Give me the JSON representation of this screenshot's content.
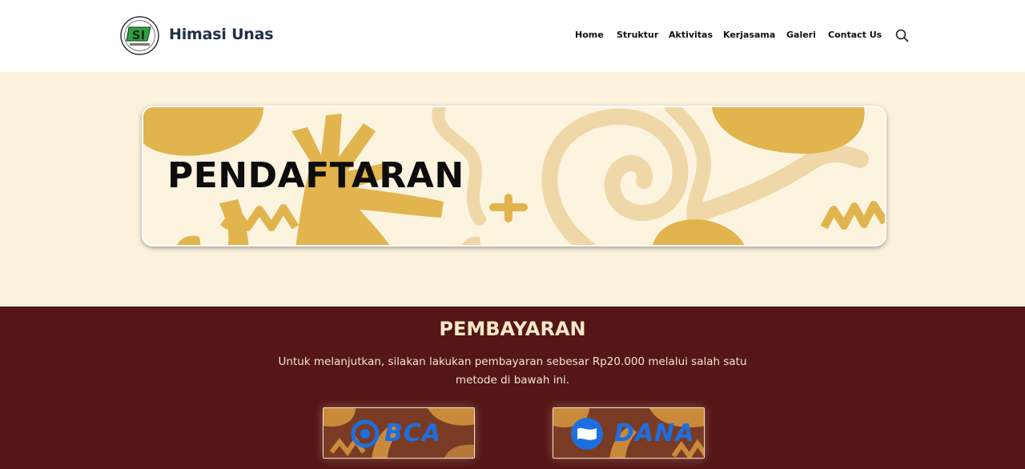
{
  "header": {
    "brand": "Himasi Unas",
    "logo_text": "SI",
    "nav": [
      {
        "label": "Home"
      },
      {
        "label": "Struktur"
      },
      {
        "label": "Aktivitas"
      },
      {
        "label": "Kerjasama"
      },
      {
        "label": "Galeri"
      },
      {
        "label": "Contact Us"
      }
    ],
    "search_icon": "search-icon"
  },
  "hero": {
    "title": "PENDAFTARAN"
  },
  "payment": {
    "title": "PEMBAYARAN",
    "description": "Untuk melanjutkan, silakan lakukan pembayaran sebesar Rp20.000 melalui salah satu metode di bawah ini.",
    "methods": [
      {
        "label": "BCA"
      },
      {
        "label": "DANA"
      }
    ]
  },
  "colors": {
    "header_bg": "#ffffff",
    "hero_bg": "#fbf1dc",
    "payment_bg": "#541616",
    "accent_mustard": "#e2b44d",
    "accent_beige": "#efd7a8",
    "brand_text": "#1f2f4a",
    "payment_logo_blue": "#1d6fe0"
  }
}
